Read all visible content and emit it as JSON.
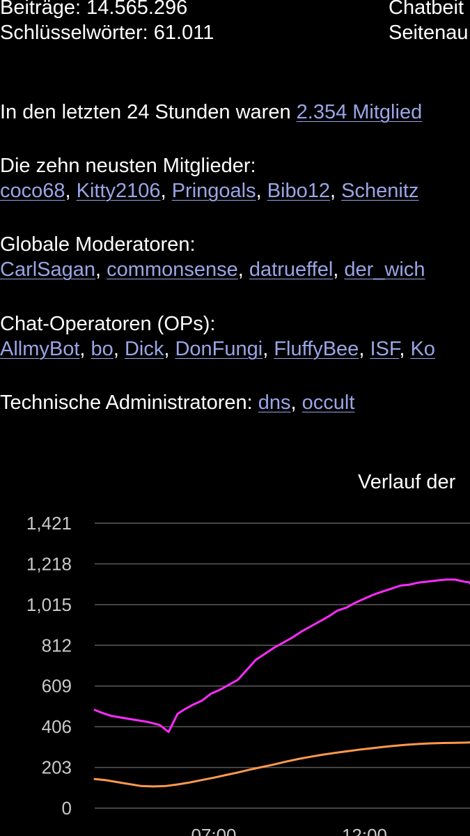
{
  "stats": {
    "posts": "Beiträge: 14.565.296",
    "keywords": "Schlüsselwörter: 61.011",
    "chat_posts": "Chatbeit",
    "page_views": "Seitenau"
  },
  "last24": {
    "prefix": "In den letzten 24 Stunden waren ",
    "link": "2.354 Mitglied"
  },
  "newest_members": {
    "heading": "Die zehn neusten Mitglieder:",
    "members": [
      "coco68",
      "Kitty2106",
      "Pringoals",
      "Bibo12",
      "Schenitz"
    ]
  },
  "global_mods": {
    "heading": "Globale Moderatoren:",
    "members": [
      "CarlSagan",
      "commonsense",
      "datrueffel",
      "der_wich"
    ]
  },
  "chat_ops": {
    "heading": "Chat-Operatoren (OPs):",
    "members": [
      "AllmyBot",
      "bo",
      "Dick",
      "DonFungi",
      "FluffyBee",
      "ISF",
      "Ko"
    ]
  },
  "tech_admins": {
    "heading": "Technische Administratoren: ",
    "members": [
      "dns",
      "occult"
    ]
  },
  "colors": {
    "link": "#9aa5e6",
    "series_magenta": "#ff2bff",
    "series_orange": "#ff9a4d",
    "grid": "#5a5a5a"
  },
  "chart_data": {
    "type": "line",
    "title": "Verlauf der",
    "ylim": [
      0,
      1421
    ],
    "yticks": [
      "1,421",
      "1,218",
      "1,015",
      "812",
      "609",
      "406",
      "203",
      "0"
    ],
    "ytick_values": [
      1421,
      1218,
      1015,
      812,
      609,
      406,
      203,
      0
    ],
    "xticks": [
      "07:00",
      "12:00"
    ],
    "xtick_hours": [
      7,
      12
    ],
    "x_hours_range": [
      3,
      15.8
    ],
    "grid": true,
    "series": [
      {
        "color": "#ff2bff",
        "x": [
          3.0,
          3.3,
          3.6,
          4.0,
          4.4,
          4.8,
          5.2,
          5.5,
          5.8,
          6.0,
          6.3,
          6.6,
          6.9,
          7.2,
          7.5,
          7.8,
          8.1,
          8.4,
          8.7,
          9.0,
          9.3,
          9.6,
          9.9,
          10.2,
          10.5,
          10.8,
          11.1,
          11.4,
          11.7,
          12.0,
          12.3,
          12.6,
          12.9,
          13.2,
          13.5,
          13.8,
          14.1,
          14.4,
          14.7,
          15.0,
          15.3,
          15.6,
          15.8
        ],
        "y": [
          490,
          475,
          460,
          450,
          440,
          430,
          415,
          380,
          470,
          490,
          515,
          535,
          570,
          590,
          615,
          640,
          690,
          740,
          770,
          800,
          825,
          850,
          880,
          905,
          930,
          955,
          985,
          1000,
          1025,
          1045,
          1065,
          1080,
          1095,
          1110,
          1115,
          1125,
          1130,
          1135,
          1140,
          1140,
          1130,
          1125,
          1120
        ]
      },
      {
        "color": "#ff9a4d",
        "x": [
          3.0,
          3.4,
          3.8,
          4.2,
          4.6,
          5.0,
          5.4,
          5.8,
          6.2,
          6.6,
          7.0,
          7.4,
          7.8,
          8.2,
          8.6,
          9.0,
          9.4,
          9.8,
          10.2,
          10.6,
          11.0,
          11.4,
          11.8,
          12.2,
          12.6,
          13.0,
          13.4,
          13.8,
          14.2,
          14.6,
          15.0,
          15.4,
          15.8
        ],
        "y": [
          145,
          140,
          130,
          120,
          110,
          108,
          110,
          118,
          128,
          140,
          152,
          165,
          178,
          192,
          205,
          218,
          232,
          245,
          256,
          266,
          275,
          283,
          291,
          298,
          305,
          311,
          316,
          320,
          323,
          325,
          326,
          327,
          328
        ]
      }
    ]
  }
}
